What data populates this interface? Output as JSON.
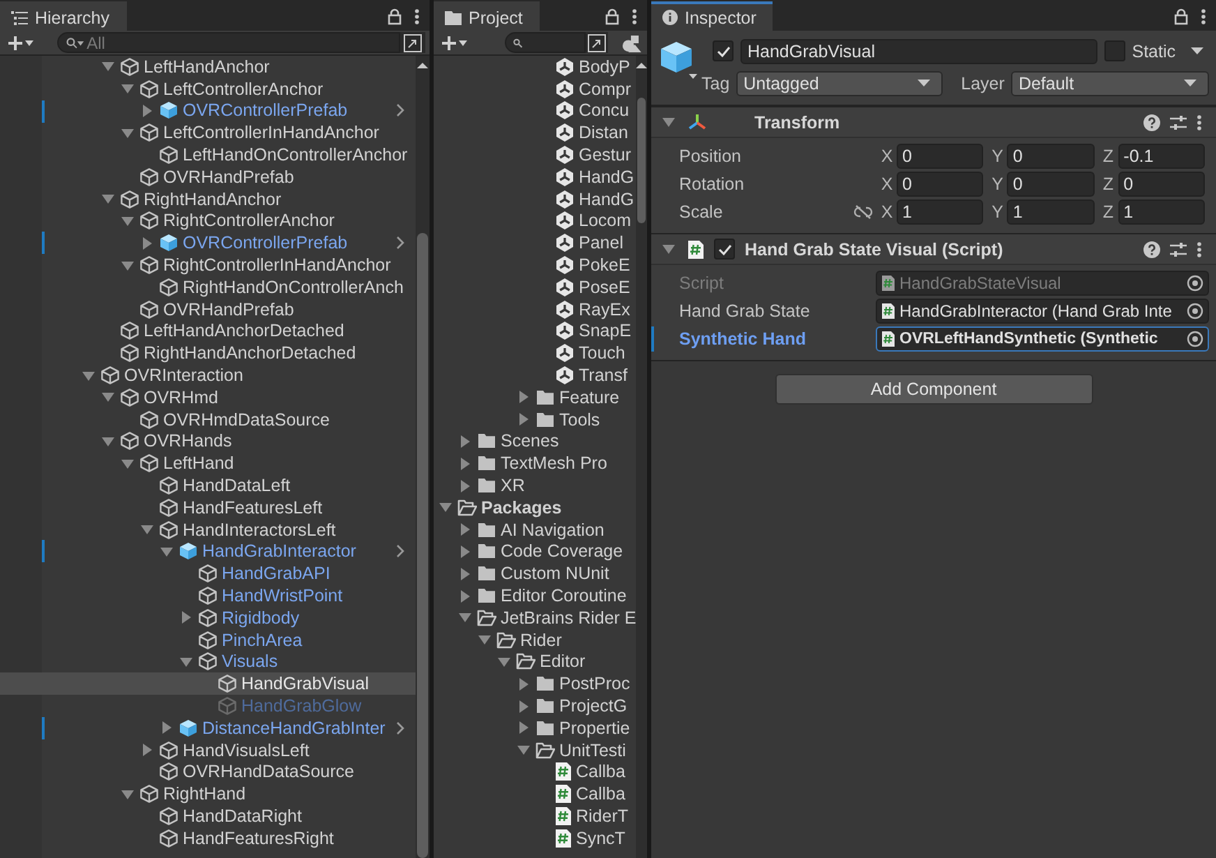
{
  "hierarchy": {
    "title": "Hierarchy",
    "search": {
      "placeholder": "All"
    },
    "items": [
      {
        "children": [
          {
            "name": "LeftHandAnchor",
            "kind": "object",
            "selected": false,
            "active": true,
            "expanded": true,
            "children": [
              {
                "name": "LeftControllerAnchor",
                "kind": "object",
                "selected": false,
                "active": true,
                "expanded": true,
                "children": [
                  {
                    "name": "OVRControllerPrefab",
                    "kind": "prefab-root",
                    "selected": false,
                    "active": true,
                    "expanded": false
                  }
                ]
              },
              {
                "name": "LeftControllerInHandAnchor",
                "kind": "object",
                "selected": false,
                "active": true,
                "expanded": true,
                "children": [
                  {
                    "name": "LeftHandOnControllerAnchor",
                    "kind": "object",
                    "selected": false,
                    "active": true
                  }
                ]
              },
              {
                "name": "OVRHandPrefab",
                "kind": "object",
                "selected": false,
                "active": true
              }
            ]
          },
          {
            "name": "RightHandAnchor",
            "kind": "object",
            "selected": false,
            "active": true,
            "expanded": true,
            "children": [
              {
                "name": "RightControllerAnchor",
                "kind": "object",
                "selected": false,
                "active": true,
                "expanded": true,
                "children": [
                  {
                    "name": "OVRControllerPrefab",
                    "kind": "prefab-root",
                    "selected": false,
                    "active": true,
                    "expanded": false
                  }
                ]
              },
              {
                "name": "RightControllerInHandAnchor",
                "kind": "object",
                "selected": false,
                "active": true,
                "expanded": true,
                "children": [
                  {
                    "name": "RightHandOnControllerAnch",
                    "kind": "object",
                    "selected": false,
                    "active": true
                  }
                ]
              },
              {
                "name": "OVRHandPrefab",
                "kind": "object",
                "selected": false,
                "active": true
              }
            ]
          },
          {
            "name": "LeftHandAnchorDetached",
            "kind": "object",
            "selected": false,
            "active": true
          },
          {
            "name": "RightHandAnchorDetached",
            "kind": "object",
            "selected": false,
            "active": true
          }
        ]
      },
      {
        "name": "OVRInteraction",
        "kind": "object",
        "selected": false,
        "active": true,
        "expanded": true,
        "children": [
          {
            "name": "OVRHmd",
            "kind": "object",
            "selected": false,
            "active": true,
            "expanded": true,
            "children": [
              {
                "name": "OVRHmdDataSource",
                "kind": "object",
                "selected": false,
                "active": true
              }
            ]
          },
          {
            "name": "OVRHands",
            "kind": "object",
            "selected": false,
            "active": true,
            "expanded": true,
            "children": [
              {
                "name": "LeftHand",
                "kind": "object",
                "selected": false,
                "active": true,
                "expanded": true,
                "children": [
                  {
                    "name": "HandDataLeft",
                    "kind": "object",
                    "selected": false,
                    "active": true
                  },
                  {
                    "name": "HandFeaturesLeft",
                    "kind": "object",
                    "selected": false,
                    "active": true
                  },
                  {
                    "name": "HandInteractorsLeft",
                    "kind": "object",
                    "selected": false,
                    "active": true,
                    "expanded": true,
                    "children": [
                      {
                        "name": "HandGrabInteractor",
                        "kind": "prefab-root",
                        "selected": false,
                        "active": true,
                        "expanded": true,
                        "children": [
                          {
                            "name": "HandGrabAPI",
                            "kind": "prefab-child",
                            "selected": false,
                            "active": true
                          },
                          {
                            "name": "HandWristPoint",
                            "kind": "prefab-child",
                            "selected": false,
                            "active": true
                          },
                          {
                            "name": "Rigidbody",
                            "kind": "prefab-child",
                            "selected": false,
                            "active": true,
                            "expanded": false
                          },
                          {
                            "name": "PinchArea",
                            "kind": "prefab-child",
                            "selected": false,
                            "active": true
                          },
                          {
                            "name": "Visuals",
                            "kind": "prefab-child",
                            "selected": false,
                            "active": true,
                            "expanded": true,
                            "children": [
                              {
                                "name": "HandGrabVisual",
                                "kind": "object",
                                "selected": true,
                                "active": true
                              },
                              {
                                "name": "HandGrabGlow",
                                "kind": "prefab-child",
                                "selected": false,
                                "active": false
                              }
                            ]
                          }
                        ]
                      },
                      {
                        "name": "DistanceHandGrabInter",
                        "kind": "prefab-root",
                        "selected": false,
                        "active": true,
                        "expanded": false
                      }
                    ]
                  },
                  {
                    "name": "HandVisualsLeft",
                    "kind": "object",
                    "selected": false,
                    "active": true,
                    "expanded": false
                  },
                  {
                    "name": "OVRHandDataSource",
                    "kind": "object",
                    "selected": false,
                    "active": true
                  }
                ]
              },
              {
                "name": "RightHand",
                "kind": "object",
                "selected": false,
                "active": true,
                "expanded": true,
                "children": [
                  {
                    "name": "HandDataRight",
                    "kind": "object",
                    "selected": false,
                    "active": true
                  },
                  {
                    "name": "HandFeaturesRight",
                    "kind": "object",
                    "selected": false,
                    "active": true
                  }
                ]
              }
            ]
          }
        ]
      }
    ]
  },
  "project": {
    "title": "Project",
    "items": [
      {
        "children": [
          {
            "children": [
              {
                "children": [
                  {
                    "children": [
                      {
                        "children": [
                          {
                            "name": "BodyP",
                            "kind": "scene"
                          },
                          {
                            "name": "Compr",
                            "kind": "scene"
                          },
                          {
                            "name": "Concu",
                            "kind": "scene"
                          },
                          {
                            "name": "Distan",
                            "kind": "scene"
                          },
                          {
                            "name": "Gestur",
                            "kind": "scene"
                          },
                          {
                            "name": "HandG",
                            "kind": "scene"
                          },
                          {
                            "name": "HandG",
                            "kind": "scene"
                          },
                          {
                            "name": "Locom",
                            "kind": "scene"
                          },
                          {
                            "name": "Panel",
                            "kind": "scene"
                          },
                          {
                            "name": "PokeE",
                            "kind": "scene"
                          },
                          {
                            "name": "PoseE",
                            "kind": "scene"
                          },
                          {
                            "name": "RayEx",
                            "kind": "scene"
                          },
                          {
                            "name": "SnapE",
                            "kind": "scene"
                          },
                          {
                            "name": "Touch",
                            "kind": "scene"
                          },
                          {
                            "name": "Transf",
                            "kind": "scene"
                          }
                        ]
                      },
                      {
                        "name": "Feature",
                        "kind": "folder",
                        "expanded": false
                      },
                      {
                        "name": "Tools",
                        "kind": "folder",
                        "expanded": false
                      }
                    ]
                  }
                ]
              }
            ]
          },
          {
            "name": "Scenes",
            "kind": "folder",
            "expanded": false
          },
          {
            "name": "TextMesh Pro",
            "kind": "folder",
            "expanded": false
          },
          {
            "name": "XR",
            "kind": "folder",
            "expanded": false
          }
        ]
      },
      {
        "name": "Packages",
        "kind": "folder",
        "expanded": true,
        "children": [
          {
            "name": "AI Navigation",
            "kind": "folder",
            "expanded": false
          },
          {
            "name": "Code Coverage",
            "kind": "folder",
            "expanded": false
          },
          {
            "name": "Custom NUnit",
            "kind": "folder",
            "expanded": false
          },
          {
            "name": "Editor Coroutine",
            "kind": "folder",
            "expanded": false
          },
          {
            "name": "JetBrains Rider E",
            "kind": "folder",
            "expanded": true,
            "children": [
              {
                "name": "Rider",
                "kind": "folder",
                "expanded": true,
                "children": [
                  {
                    "name": "Editor",
                    "kind": "folder",
                    "expanded": true,
                    "children": [
                      {
                        "name": "PostProc",
                        "kind": "folder",
                        "expanded": false
                      },
                      {
                        "name": "ProjectG",
                        "kind": "folder",
                        "expanded": false
                      },
                      {
                        "name": "Propertie",
                        "kind": "folder",
                        "expanded": false
                      },
                      {
                        "name": "UnitTesti",
                        "kind": "folder",
                        "expanded": true,
                        "children": [
                          {
                            "name": "Callba",
                            "kind": "script"
                          },
                          {
                            "name": "Callba",
                            "kind": "script"
                          },
                          {
                            "name": "RiderT",
                            "kind": "script"
                          },
                          {
                            "name": "SyncT",
                            "kind": "script"
                          }
                        ]
                      }
                    ]
                  }
                ]
              }
            ]
          }
        ]
      }
    ]
  },
  "inspector": {
    "title": "Inspector",
    "object": {
      "name": "HandGrabVisual",
      "active": true,
      "static": false,
      "static_label": "Static",
      "tag_label": "Tag",
      "tag": "Untagged",
      "layer_label": "Layer",
      "layer": "Default"
    },
    "components": [
      {
        "kind": "transform",
        "title": "Transform",
        "expanded": true,
        "rows": [
          {
            "label": "Position",
            "values": [
              {
                "axis": "X",
                "value": "0"
              },
              {
                "axis": "Y",
                "value": "0"
              },
              {
                "axis": "Z",
                "value": "-0.1"
              }
            ]
          },
          {
            "label": "Rotation",
            "values": [
              {
                "axis": "X",
                "value": "0"
              },
              {
                "axis": "Y",
                "value": "0"
              },
              {
                "axis": "Z",
                "value": "0"
              }
            ]
          },
          {
            "label": "Scale",
            "constrained": false,
            "values": [
              {
                "axis": "X",
                "value": "1"
              },
              {
                "axis": "Y",
                "value": "1"
              },
              {
                "axis": "Z",
                "value": "1"
              }
            ]
          }
        ]
      },
      {
        "kind": "script",
        "title": "Hand Grab State Visual (Script)",
        "expanded": true,
        "enabled": true,
        "fields": [
          {
            "label": "Script",
            "value": "HandGrabStateVisual",
            "disabled": true,
            "overridden": false,
            "focused": false
          },
          {
            "label": "Hand Grab State",
            "value": "HandGrabInteractor (Hand Grab Inte",
            "disabled": false,
            "overridden": false,
            "focused": false
          },
          {
            "label": "Synthetic Hand",
            "value": "OVRLeftHandSynthetic (Synthetic",
            "disabled": false,
            "overridden": true,
            "focused": true
          }
        ]
      }
    ],
    "add_component": "Add Component"
  }
}
